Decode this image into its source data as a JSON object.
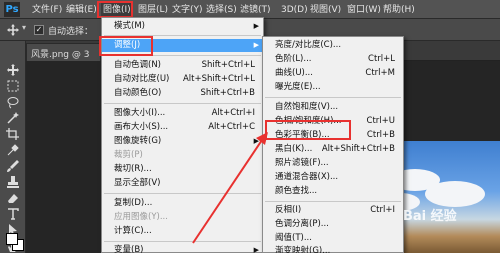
{
  "app": {
    "logo": "Ps"
  },
  "menubar": {
    "items": [
      "文件(F)",
      "编辑(E)",
      "图像(I)",
      "图层(L)",
      "文字(Y)",
      "选择(S)",
      "滤镜(T)",
      "3D(D)",
      "视图(V)",
      "窗口(W)",
      "帮助(H)"
    ]
  },
  "options": {
    "auto_select": "自动选择：",
    "checked_mark": "✓"
  },
  "tab": {
    "label": "风景.png @ 3"
  },
  "image_menu": [
    {
      "label": "模式(M)",
      "shortcut": "",
      "submenu": true
    },
    {
      "label": "调整(J)",
      "shortcut": "",
      "submenu": true,
      "highlight": true
    },
    {
      "label": "自动色调(N)",
      "shortcut": "Shift+Ctrl+L"
    },
    {
      "label": "自动对比度(U)",
      "shortcut": "Alt+Shift+Ctrl+L"
    },
    {
      "label": "自动颜色(O)",
      "shortcut": "Shift+Ctrl+B"
    },
    {
      "label": "图像大小(I)...",
      "shortcut": "Alt+Ctrl+I"
    },
    {
      "label": "画布大小(S)...",
      "shortcut": "Alt+Ctrl+C"
    },
    {
      "label": "图像旋转(G)",
      "shortcut": ""
    },
    {
      "label": "裁剪(P)",
      "shortcut": "",
      "disabled": true
    },
    {
      "label": "裁切(R)...",
      "shortcut": ""
    },
    {
      "label": "显示全部(V)",
      "shortcut": ""
    },
    {
      "label": "复制(D)...",
      "shortcut": ""
    },
    {
      "label": "应用图像(Y)...",
      "shortcut": "",
      "disabled": true
    },
    {
      "label": "计算(C)...",
      "shortcut": ""
    },
    {
      "label": "变量(B)",
      "shortcut": "",
      "submenu": true
    }
  ],
  "adjust_menu": [
    {
      "label": "亮度/对比度(C)...",
      "shortcut": ""
    },
    {
      "label": "色阶(L)...",
      "shortcut": "Ctrl+L"
    },
    {
      "label": "曲线(U)...",
      "shortcut": "Ctrl+M"
    },
    {
      "label": "曝光度(E)...",
      "shortcut": ""
    },
    {
      "label": "自然饱和度(V)...",
      "shortcut": ""
    },
    {
      "label": "色相/饱和度(H)...",
      "shortcut": "Ctrl+U"
    },
    {
      "label": "色彩平衡(B)...",
      "shortcut": "Ctrl+B"
    },
    {
      "label": "黑白(K)...",
      "shortcut": "Alt+Shift+Ctrl+B"
    },
    {
      "label": "照片滤镜(F)...",
      "shortcut": ""
    },
    {
      "label": "通道混合器(X)...",
      "shortcut": ""
    },
    {
      "label": "颜色查找...",
      "shortcut": ""
    },
    {
      "label": "反相(I)",
      "shortcut": "Ctrl+I"
    },
    {
      "label": "色调分离(P)...",
      "shortcut": ""
    },
    {
      "label": "阈值(T)...",
      "shortcut": ""
    },
    {
      "label": "渐变映射(G)...",
      "shortcut": ""
    }
  ],
  "watermark": "Bai 经验",
  "colors": {
    "highlight": "#4da4f7",
    "annotation_red": "#e8312f"
  }
}
